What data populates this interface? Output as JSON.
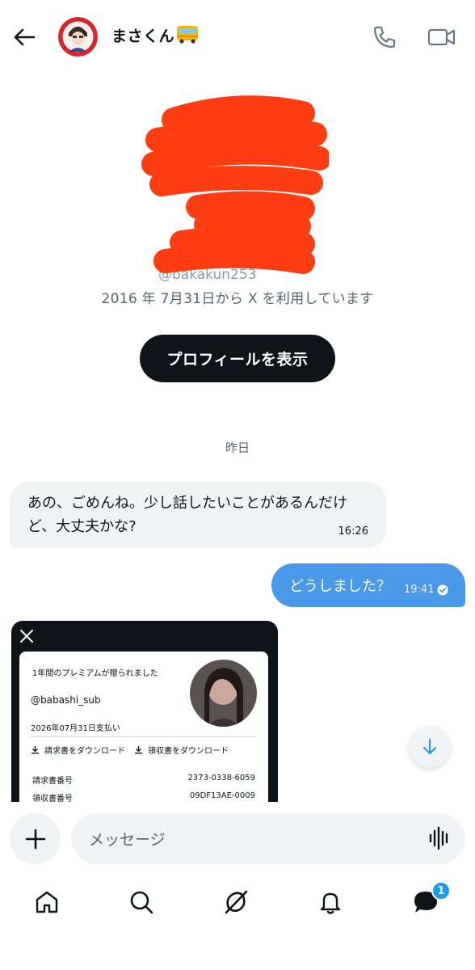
{
  "header": {
    "name": "まさくん",
    "name_emoji": "bus-emoji"
  },
  "profile": {
    "handle_peek": "@bakakun253",
    "joined_text": "2016 年 7月31日から X を利用しています",
    "view_profile_label": "プロフィールを表示"
  },
  "date_separator": "昨日",
  "messages": [
    {
      "direction": "incoming",
      "text": "あの、ごめんね。少し話したいことがあるんだけど、大丈夫かな?",
      "time": "16:26"
    },
    {
      "direction": "outgoing",
      "text": "どうしました？",
      "time": "19:41",
      "status": "read-check-icon"
    }
  ],
  "receipt": {
    "title": "1年間のプレミアムが贈られました",
    "handle": "@babashi_sub",
    "paid_date": "2026年07月31日支払い",
    "download_invoice": "請求書をダウンロード",
    "download_receipt": "領収書をダウンロード",
    "rows": [
      {
        "label": "請求書番号",
        "value": "2373-0338-6059"
      },
      {
        "label": "領収書番号",
        "value": "09DF13AE-0009"
      }
    ]
  },
  "composer": {
    "placeholder": "メッセージ"
  },
  "nav": {
    "items": [
      "home-icon",
      "search-icon",
      "grok-icon",
      "bell-icon",
      "messages-icon"
    ],
    "messages_badge": "1"
  },
  "colors": {
    "accent": "#1d9bf0",
    "outgoing_bubble": "#4a99e9",
    "incoming_bubble": "#eff3f4",
    "redaction": "#ff3d12"
  }
}
